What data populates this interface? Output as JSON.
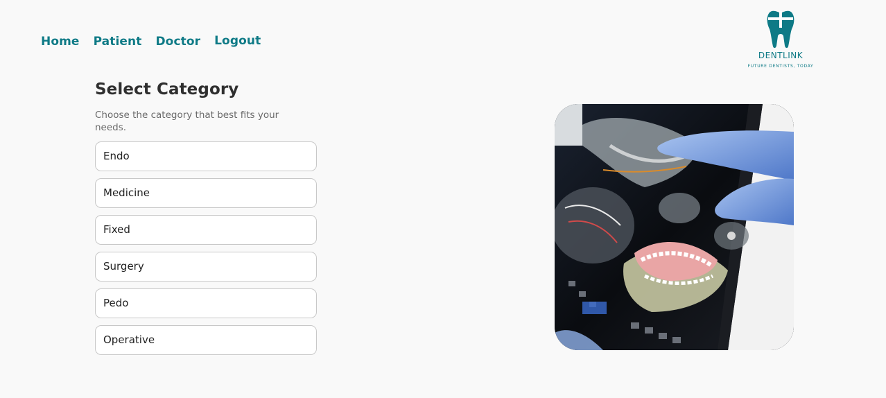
{
  "nav": {
    "items": [
      {
        "label": "Home"
      },
      {
        "label": "Patient"
      },
      {
        "label": "Doctor"
      },
      {
        "label": "Logout"
      }
    ]
  },
  "logo": {
    "brand": "DENTLINK",
    "tagline": "FUTURE DENTISTS, TODAY",
    "icon": "tooth-icon"
  },
  "main": {
    "title": "Select Category",
    "subtitle": "Choose the category that best fits your needs.",
    "options": [
      {
        "label": "Endo"
      },
      {
        "label": "Medicine"
      },
      {
        "label": "Fixed"
      },
      {
        "label": "Surgery"
      },
      {
        "label": "Pedo"
      },
      {
        "label": "Operative"
      }
    ]
  },
  "hero_image": {
    "subject": "dental x-ray tablet illustration"
  },
  "colors": {
    "accent": "#0e7a86",
    "background": "#f9f9f9",
    "heading": "#2f2f2f",
    "muted": "#6a6a6a"
  }
}
